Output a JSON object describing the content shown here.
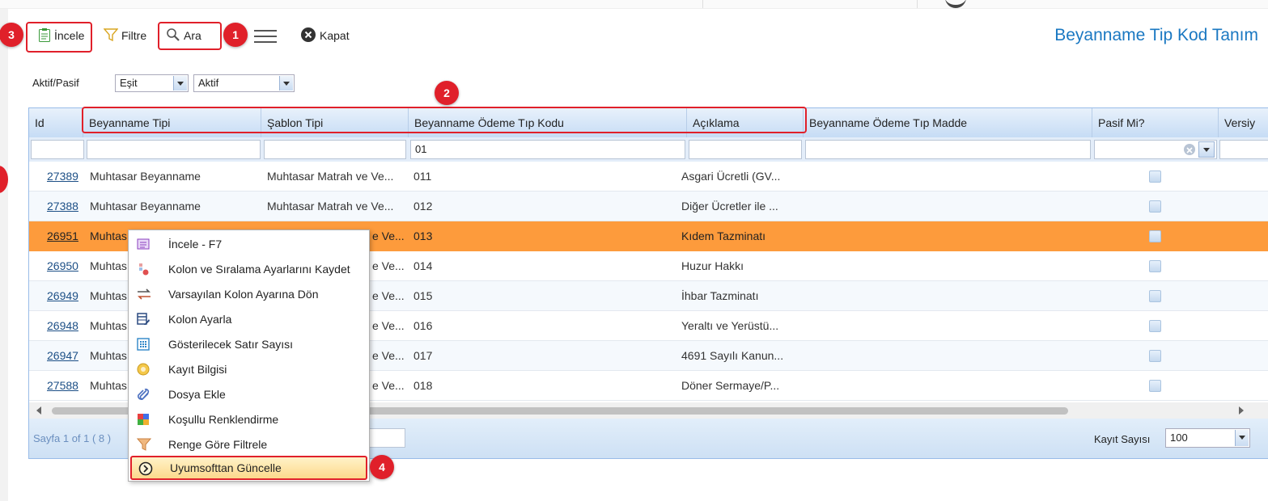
{
  "toolbar": {
    "incele": "İncele",
    "filtre": "Filtre",
    "ara": "Ara",
    "kapat": "Kapat",
    "title": "Beyanname Tip Kod Tanım"
  },
  "badges": [
    "1",
    "2",
    "3",
    "4"
  ],
  "filter": {
    "label": "Aktif/Pasif",
    "operator": "Eşit",
    "value": "Aktif"
  },
  "grid": {
    "columns": [
      "Id",
      "Beyanname Tipi",
      "Şablon Tipi",
      "Beyanname Ödeme Tıp Kodu",
      "Açıklama",
      "Beyanname Ödeme Tıp Madde",
      "Pasif Mi?",
      "Versiy"
    ],
    "filter_values": {
      "odeme_tip_kodu": "01"
    },
    "rows": [
      {
        "id": "27389",
        "tip": "Muhtasar Beyanname",
        "sablon": "Muhtasar Matrah ve Ve...",
        "kod": "011",
        "aciklama": "Asgari Ücretli (GV..."
      },
      {
        "id": "27388",
        "tip": "Muhtasar Beyanname",
        "sablon": "Muhtasar Matrah ve Ve...",
        "kod": "012",
        "aciklama": "Diğer Ücretler ile ..."
      },
      {
        "id": "26951",
        "tip": "Muhtas",
        "sablon": "e Ve...",
        "kod": "013",
        "aciklama": "Kıdem Tazminatı"
      },
      {
        "id": "26950",
        "tip": "Muhtas",
        "sablon": "e Ve...",
        "kod": "014",
        "aciklama": "Huzur Hakkı"
      },
      {
        "id": "26949",
        "tip": "Muhtas",
        "sablon": "e Ve...",
        "kod": "015",
        "aciklama": "İhbar Tazminatı"
      },
      {
        "id": "26948",
        "tip": "Muhtas",
        "sablon": "e Ve...",
        "kod": "016",
        "aciklama": "Yeraltı ve Yerüstü..."
      },
      {
        "id": "26947",
        "tip": "Muhtas",
        "sablon": "e Ve...",
        "kod": "017",
        "aciklama": "4691 Sayılı Kanun..."
      },
      {
        "id": "27588",
        "tip": "Muhtas",
        "sablon": "e Ve...",
        "kod": "018",
        "aciklama": "Döner Sermaye/P..."
      }
    ],
    "selected_id": "26951"
  },
  "pager": {
    "page_text": "Sayfa 1 of 1 ( 8 )",
    "kayit_label": "Kayıt Sayısı",
    "kayit_value": "100"
  },
  "context_menu": {
    "items": [
      {
        "label": "İncele - F7",
        "icon": "inspect-icon"
      },
      {
        "label": "Kolon ve Sıralama Ayarlarını Kaydet",
        "icon": "save-settings-icon"
      },
      {
        "label": "Varsayılan Kolon Ayarına Dön",
        "icon": "reset-arrows-icon"
      },
      {
        "label": "Kolon Ayarla",
        "icon": "column-edit-icon"
      },
      {
        "label": "Gösterilecek Satır Sayısı",
        "icon": "grid-rows-icon"
      },
      {
        "label": "Kayıt Bilgisi",
        "icon": "info-icon"
      },
      {
        "label": "Dosya Ekle",
        "icon": "paperclip-icon"
      },
      {
        "label": "Koşullu Renklendirme",
        "icon": "color-grid-icon"
      },
      {
        "label": "Renge Göre Filtrele",
        "icon": "funnel-icon"
      },
      {
        "label": "Uyumsofttan Güncelle",
        "icon": "update-circle-icon"
      }
    ]
  },
  "colors": {
    "accent": "#1a78c2",
    "selected_row": "#fd9b3c",
    "annotation_red": "#e0202a"
  }
}
